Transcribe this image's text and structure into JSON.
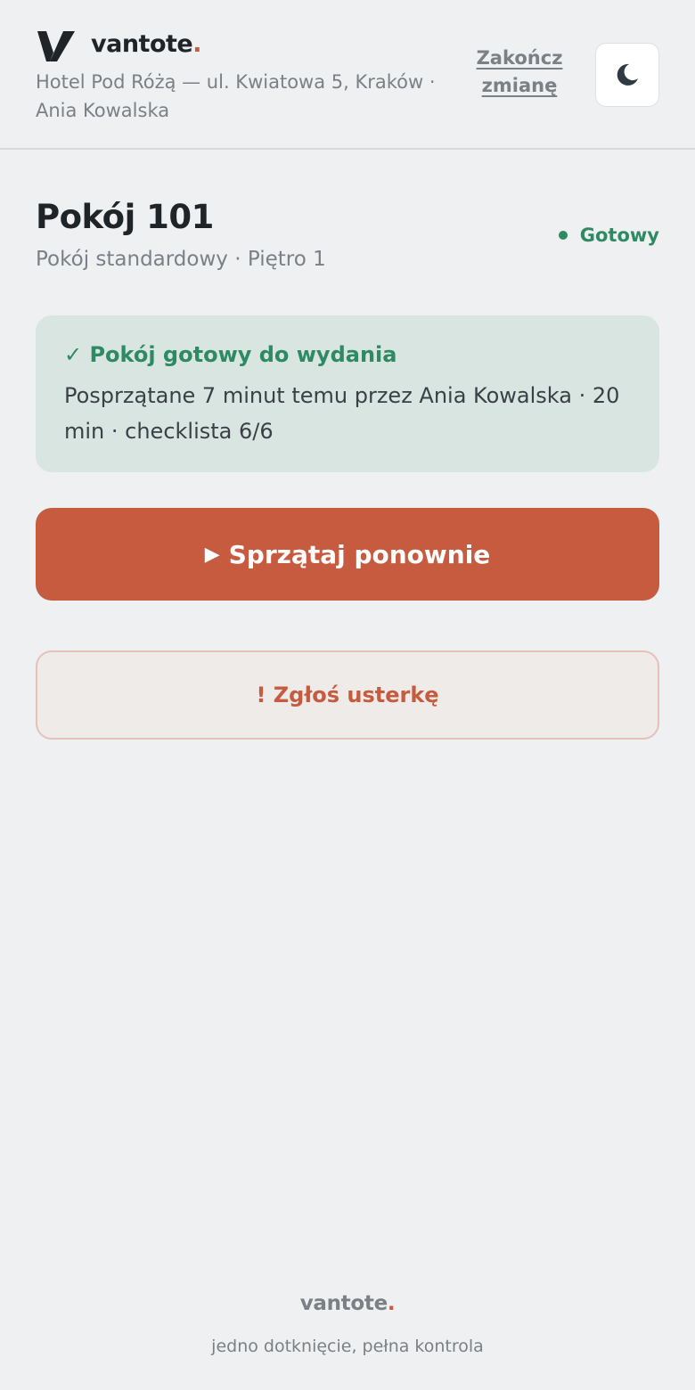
{
  "header": {
    "brand_name": "vantote",
    "brand_dot": ".",
    "hotel_line": "Hotel Pod Różą — ul. Kwiatowa 5, Kraków · Ania Kowalska",
    "end_shift_label": "Zakończ zmianę",
    "theme_icon": "moon-icon"
  },
  "room": {
    "title": "Pokój 101",
    "subtitle": "Pokój standardowy · Piętro 1",
    "status": "Gotowy"
  },
  "ready_card": {
    "check": "✓",
    "title": "Pokój gotowy do wydania",
    "detail": "Posprzątane 7 minut temu przez Ania Kowalska · 20 min · checklista 6/6"
  },
  "actions": {
    "clean_again_icon": "▶",
    "clean_again_label": "Sprzątaj ponownie",
    "report_issue_label": "! Zgłoś usterkę"
  },
  "footer": {
    "brand_name": "vantote",
    "brand_dot": ".",
    "tagline": "jedno dotknięcie, pełna kontrola"
  },
  "colors": {
    "accent": "#c65b40",
    "success": "#2e8a62",
    "background": "#eff0f1",
    "card_success_bg": "#d9e5e1"
  }
}
